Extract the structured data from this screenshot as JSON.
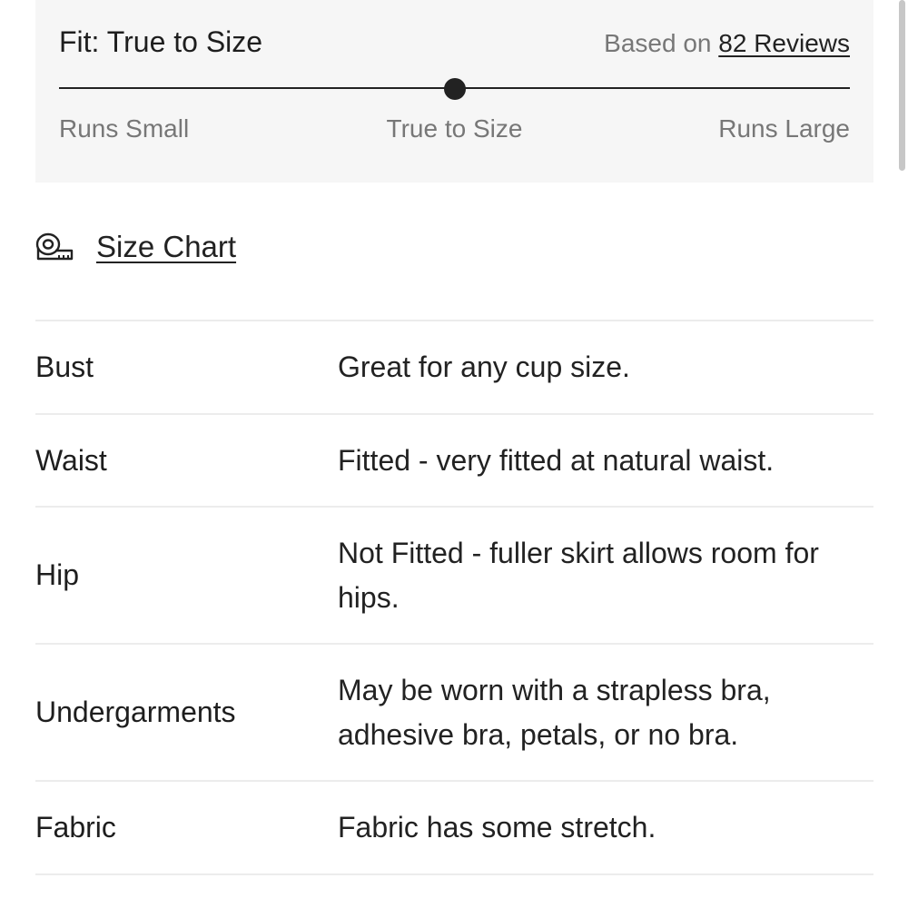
{
  "fit": {
    "title": "Fit: True to Size",
    "based_on_prefix": "Based on",
    "reviews_link": "82 Reviews",
    "scale": {
      "left_label": "Runs Small",
      "center_label": "True to Size",
      "right_label": "Runs Large",
      "value": 0.5
    }
  },
  "size_chart": {
    "icon": "measuring-tape-icon",
    "label": "Size Chart"
  },
  "fit_details": [
    {
      "label": "Bust",
      "value": "Great for any cup size."
    },
    {
      "label": "Waist",
      "value": "Fitted - very fitted at natural waist."
    },
    {
      "label": "Hip",
      "value": "Not Fitted - fuller skirt allows room for hips."
    },
    {
      "label": "Undergarments",
      "value": "May be worn with a strapless bra, adhesive bra, petals, or no bra."
    },
    {
      "label": "Fabric",
      "value": "Fabric has some stretch."
    }
  ],
  "colors": {
    "card_background": "#f6f6f6",
    "text": "#222222",
    "muted_text": "#777777",
    "divider": "#ececec"
  }
}
